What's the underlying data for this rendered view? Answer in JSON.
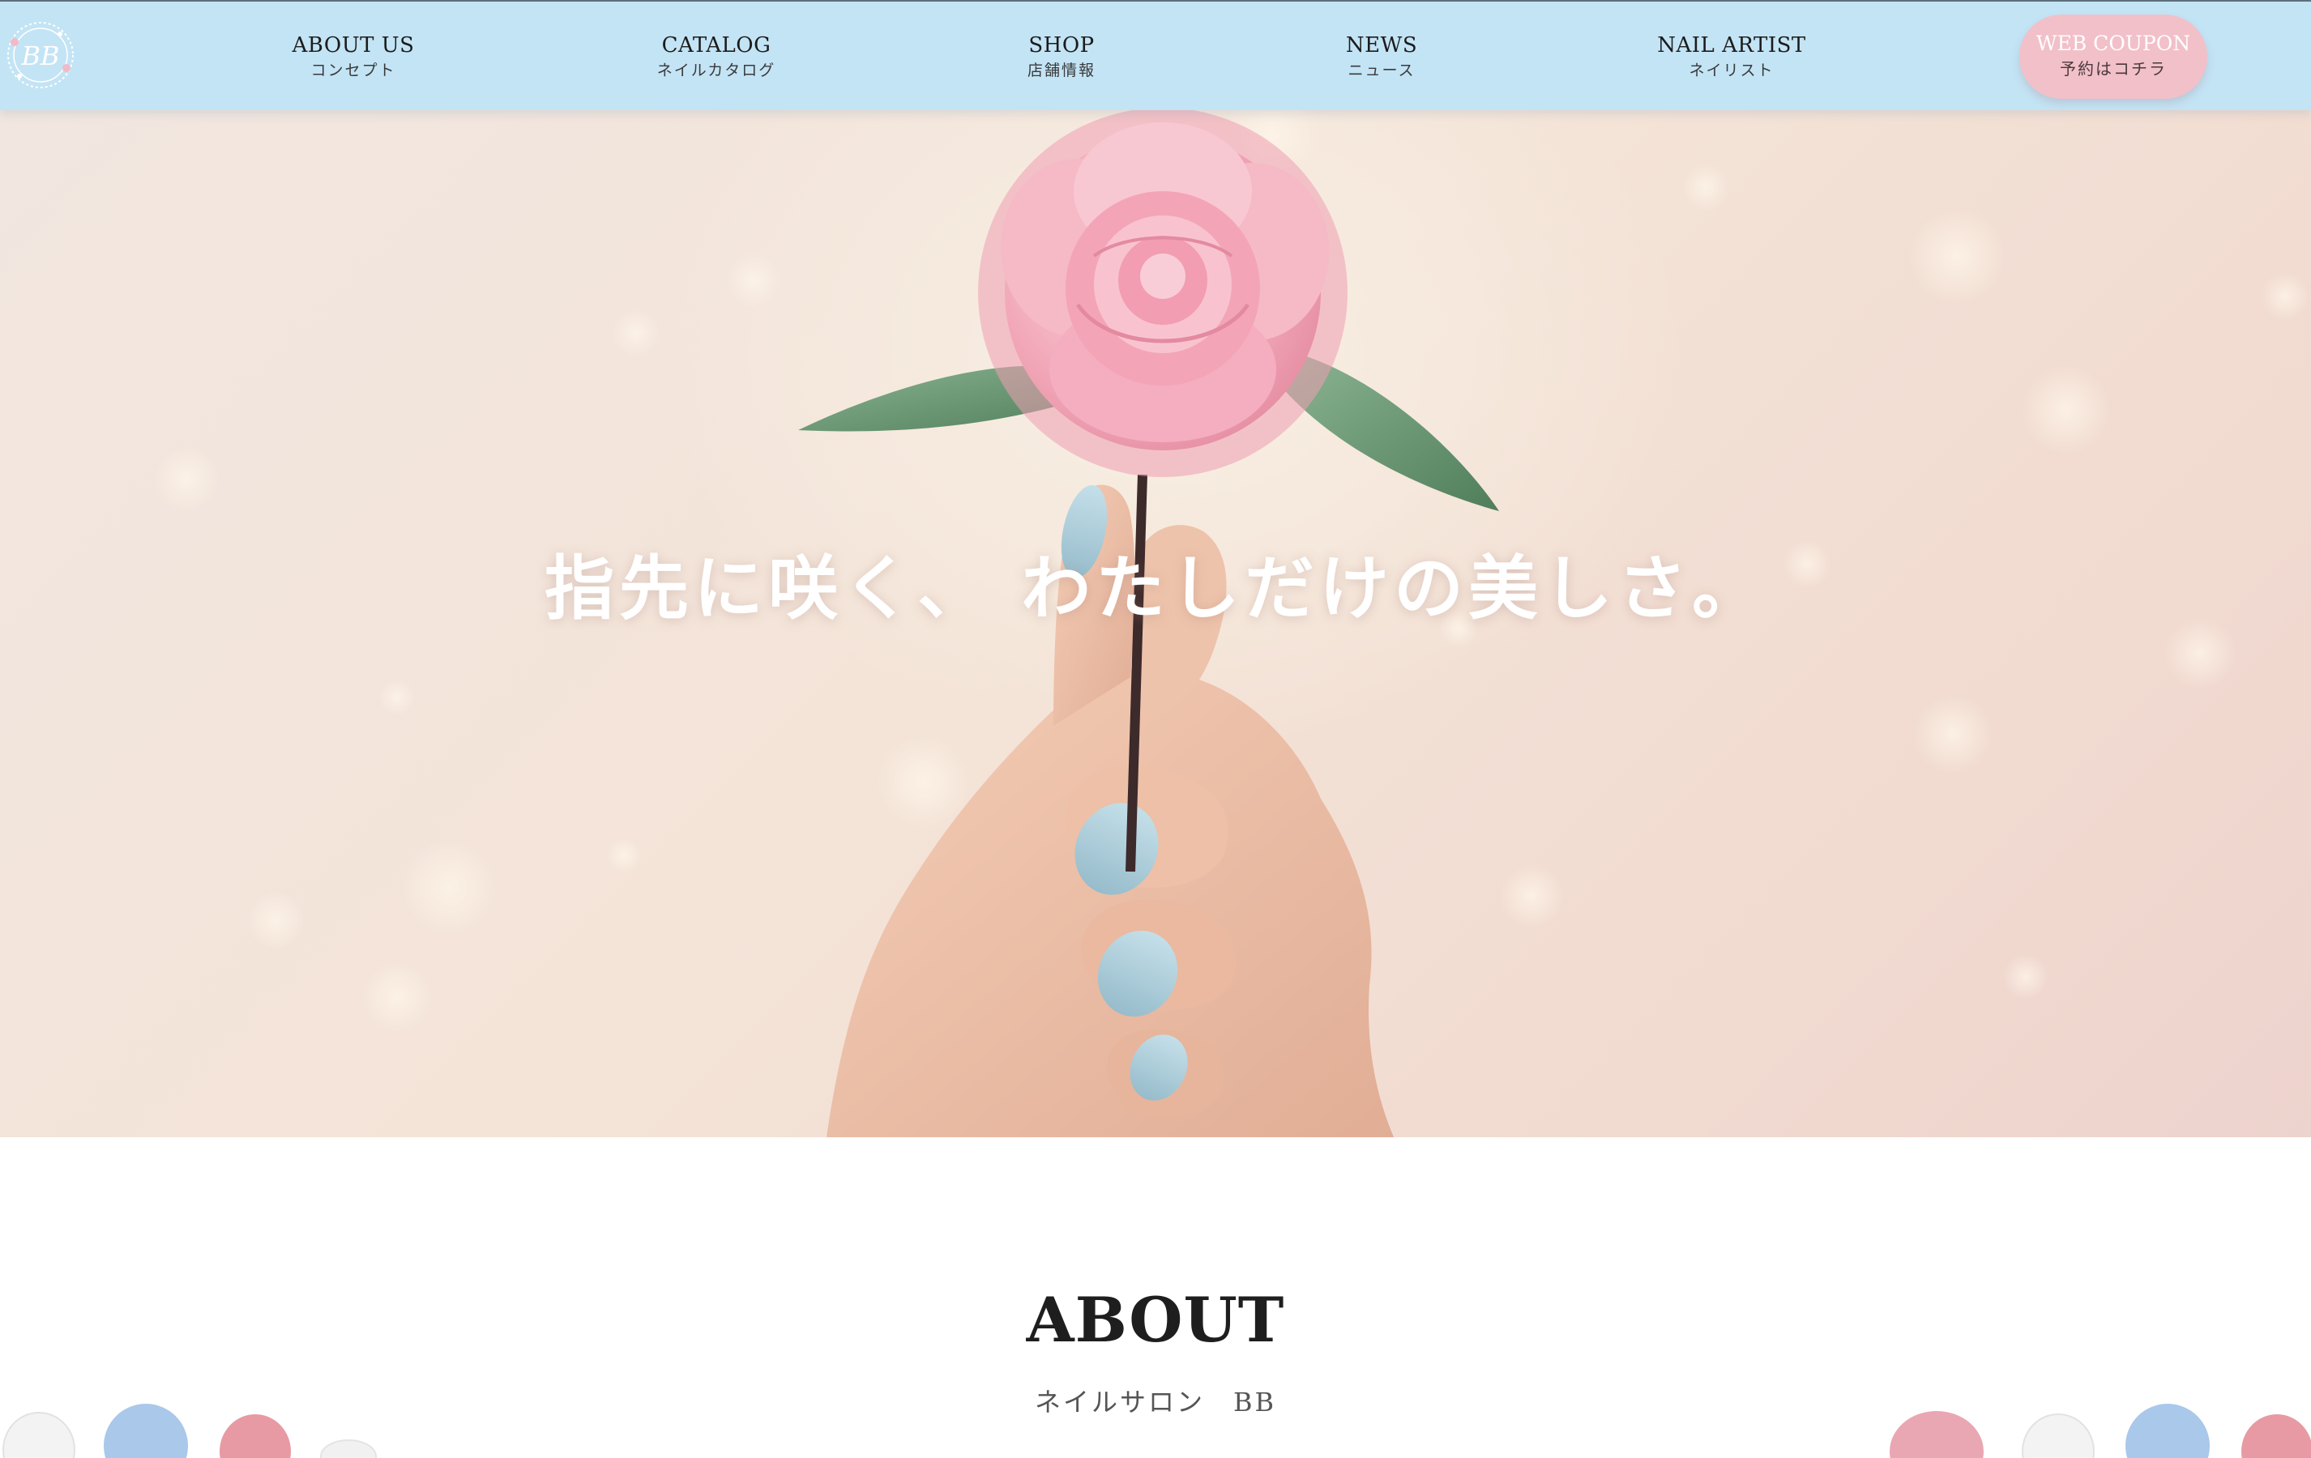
{
  "header": {
    "logo_text": "BB",
    "nav": [
      {
        "en": "ABOUT US",
        "ja": "コンセプト"
      },
      {
        "en": "CATALOG",
        "ja": "ネイルカタログ"
      },
      {
        "en": "SHOP",
        "ja": "店舗情報"
      },
      {
        "en": "NEWS",
        "ja": "ニュース"
      },
      {
        "en": "NAIL ARTIST",
        "ja": "ネイリスト"
      }
    ],
    "coupon": {
      "en": "WEB COUPON",
      "ja": "予約はコチラ"
    }
  },
  "hero": {
    "tagline": "指先に咲く、 わたしだけの美しさ。"
  },
  "about": {
    "title": "ABOUT",
    "subtitle": "ネイルサロン　BB"
  },
  "colors": {
    "header_bg": "#c3e4f5",
    "coupon_bg": "#f2c0c9",
    "nail_blue": "#a9c9d6",
    "camellia_pink": "#f2a9b9"
  }
}
